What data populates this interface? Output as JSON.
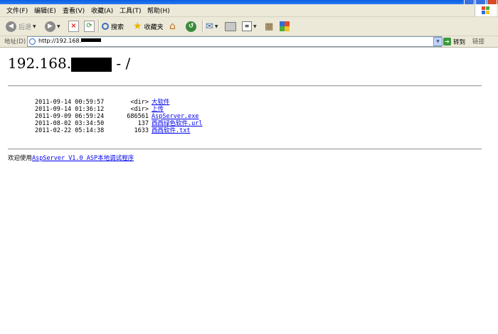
{
  "menu": [
    "文件(F)",
    "编辑(E)",
    "查看(V)",
    "收藏(A)",
    "工具(T)",
    "帮助(H)"
  ],
  "toolbar": {
    "back_label": "后退",
    "search_label": "搜索",
    "favorites_label": "收藏夹"
  },
  "address": {
    "label": "地址(D)",
    "value": "http://192.168.",
    "go_label": "转到",
    "links_label": "链接"
  },
  "page": {
    "heading_prefix": "192.168.",
    "heading_suffix": " - /",
    "rows": [
      {
        "date": "2011-09-14 00:59:57",
        "size": "<dir>",
        "name": "大软件"
      },
      {
        "date": "2011-09-14 01:36:12",
        "size": "<dir>",
        "name": "上传"
      },
      {
        "date": "2011-09-09 06:59:24",
        "size": "686561",
        "name": "AspServer.exe"
      },
      {
        "date": "2011-08-02 03:34:50",
        "size": "137",
        "name": "西西绿色软件.url"
      },
      {
        "date": "2011-02-22 05:14:38",
        "size": "1633",
        "name": "西西软件.txt"
      }
    ],
    "footer_prefix": "欢迎使用",
    "footer_link": "AspServer V1.0 ASP本地调试程序"
  }
}
